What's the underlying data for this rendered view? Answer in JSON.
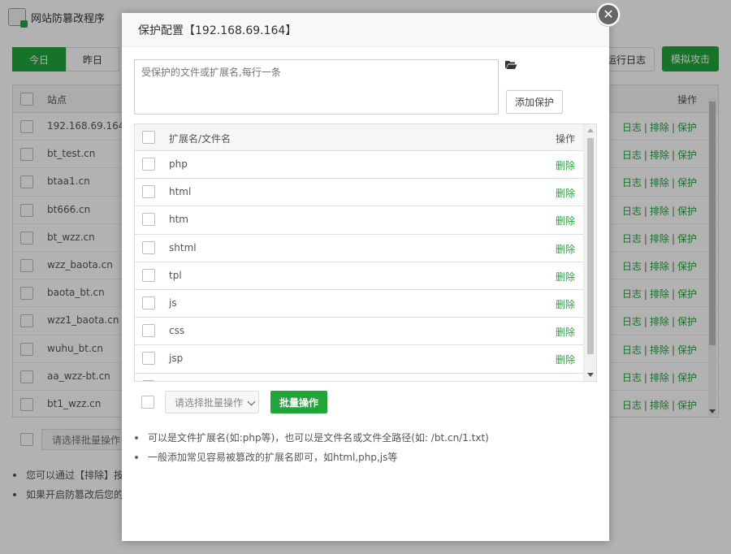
{
  "app": {
    "title": "网站防篡改程序"
  },
  "toolbar": {
    "tabs": [
      {
        "label": "今日"
      },
      {
        "label": "昨日"
      }
    ],
    "log_button": "运行日志",
    "attack_button": "模拟攻击"
  },
  "sites_table": {
    "headers": {
      "site": "站点",
      "ops": "操作"
    },
    "rows": [
      {
        "site": "192.168.69.164"
      },
      {
        "site": "bt_test.cn"
      },
      {
        "site": "btaa1.cn"
      },
      {
        "site": "bt666.cn"
      },
      {
        "site": "bt_wzz.cn"
      },
      {
        "site": "wzz_baota.cn"
      },
      {
        "site": "baota_bt.cn"
      },
      {
        "site": "wzz1_baota.cn"
      },
      {
        "site": "wuhu_bt.cn"
      },
      {
        "site": "aa_wzz-bt.cn"
      },
      {
        "site": "bt1_wzz.cn"
      }
    ],
    "row_ops": {
      "log": "日志",
      "exclude": "排除",
      "protect": "保护",
      "sep": "|"
    }
  },
  "bg_batch": {
    "select_placeholder": "请选择批量操作"
  },
  "bg_notes": [
    "您可以通过【排除】按",
    "如果开启防篡改后您的"
  ],
  "modal": {
    "title": "保护配置【192.168.69.164】",
    "close_icon": "close-icon",
    "textarea_placeholder": "受保护的文件或扩展名,每行一条",
    "folder_icon": "folder-open-icon",
    "add_button": "添加保护",
    "table": {
      "headers": {
        "name": "扩展名/文件名",
        "ops": "操作"
      },
      "rows": [
        {
          "name": "php",
          "op": "删除"
        },
        {
          "name": "html",
          "op": "删除"
        },
        {
          "name": "htm",
          "op": "删除"
        },
        {
          "name": "shtml",
          "op": "删除"
        },
        {
          "name": "tpl",
          "op": "删除"
        },
        {
          "name": "js",
          "op": "删除"
        },
        {
          "name": "css",
          "op": "删除"
        },
        {
          "name": "jsp",
          "op": "删除"
        }
      ]
    },
    "batch": {
      "select_placeholder": "请选择批量操作",
      "button": "批量操作"
    },
    "notes": [
      "可以是文件扩展名(如:php等)，也可以是文件名或文件全路径(如: /bt.cn/1.txt)",
      "一般添加常见容易被篡改的扩展名即可，如html,php,js等"
    ]
  },
  "colors": {
    "accent": "#20a53a",
    "overlay": "rgba(0,0,0,0.3)"
  }
}
